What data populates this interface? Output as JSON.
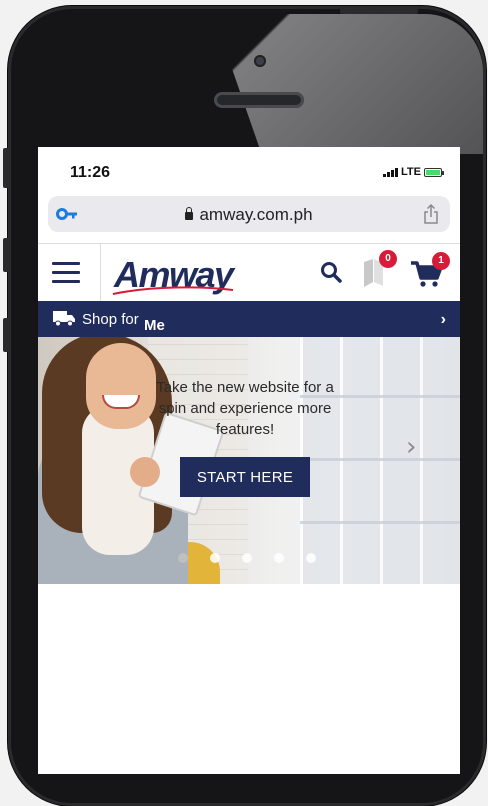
{
  "status_bar": {
    "time": "11:26",
    "network": "LTE"
  },
  "browser": {
    "url": "amway.com.ph"
  },
  "header": {
    "logo": "Amway",
    "shopping_list_count": "0",
    "cart_count": "1"
  },
  "shop_bar": {
    "label": "Shop for",
    "value": "Me",
    "chevron": "›"
  },
  "hero": {
    "text": "Take the new website for a spin and experience more features!",
    "button_label": "START HERE",
    "next_arrow": "›",
    "slide_count": 5,
    "active_slide": 1
  },
  "colors": {
    "brand_navy": "#1f2c5c",
    "badge_red": "#d81b39",
    "battery_green": "#4cd964"
  },
  "icons": [
    "password-key-icon",
    "lock-icon",
    "share-icon",
    "hamburger-menu-icon",
    "search-icon",
    "shopping-list-icon",
    "cart-icon",
    "truck-icon",
    "chevron-right-icon"
  ]
}
